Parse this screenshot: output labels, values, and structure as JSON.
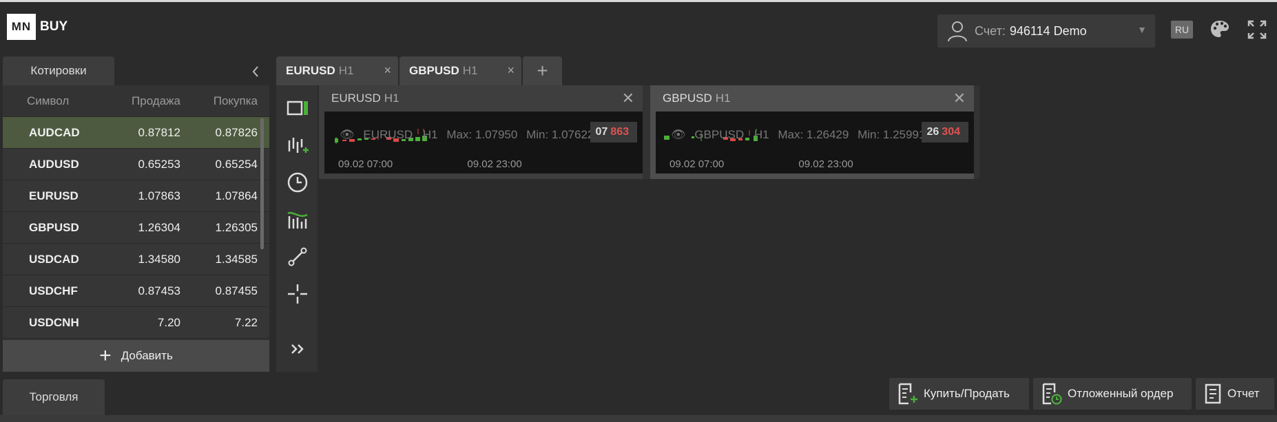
{
  "header": {
    "logo_box": "MN",
    "logo_text": "BUY",
    "account_label": "Счет:",
    "account_value": "946114 Demo",
    "lang": "RU"
  },
  "quotes": {
    "tab_label": "Котировки",
    "columns": {
      "symbol": "Символ",
      "sell": "Продажа",
      "buy": "Покупка"
    },
    "rows": [
      {
        "symbol": "AUDCAD",
        "sell": "0.87812",
        "buy": "0.87826"
      },
      {
        "symbol": "AUDUSD",
        "sell": "0.65253",
        "buy": "0.65254"
      },
      {
        "symbol": "EURUSD",
        "sell": "1.07863",
        "buy": "1.07864"
      },
      {
        "symbol": "GBPUSD",
        "sell": "1.26304",
        "buy": "1.26305"
      },
      {
        "symbol": "USDCAD",
        "sell": "1.34580",
        "buy": "1.34585"
      },
      {
        "symbol": "USDCHF",
        "sell": "0.87453",
        "buy": "0.87455"
      },
      {
        "symbol": "USDCNH",
        "sell": "7.20",
        "buy": "7.22"
      }
    ],
    "add_label": "Добавить"
  },
  "chart_tabs": [
    {
      "symbol": "EURUSD",
      "tf": "H1"
    },
    {
      "symbol": "GBPUSD",
      "tf": "H1"
    }
  ],
  "charts": [
    {
      "symbol": "EURUSD",
      "tf": "H1",
      "info_symbol": "EURUSD",
      "info_tf": "H1",
      "max": "Max: 1.07950",
      "min": "Min: 1.07622",
      "price_a": "07",
      "price_b": "863",
      "t1": "09.02 07:00",
      "t2": "09.02 23:00"
    },
    {
      "symbol": "GBPUSD",
      "tf": "H1",
      "info_symbol": "GBPUSD",
      "info_tf": "H1",
      "max": "Max: 1.26429",
      "min": "Min: 1.25991",
      "price_a": "26",
      "price_b": "304",
      "t1": "09.02 07:00",
      "t2": "09.02 23:00"
    }
  ],
  "bottom": {
    "trade_tab": "Торговля",
    "buy_sell": "Купить/Продать",
    "pending": "Отложенный ордер",
    "report": "Отчет"
  },
  "colors": {
    "up": "#4caf3a",
    "down": "#d94848",
    "selected_row": "#4d5a3f"
  }
}
